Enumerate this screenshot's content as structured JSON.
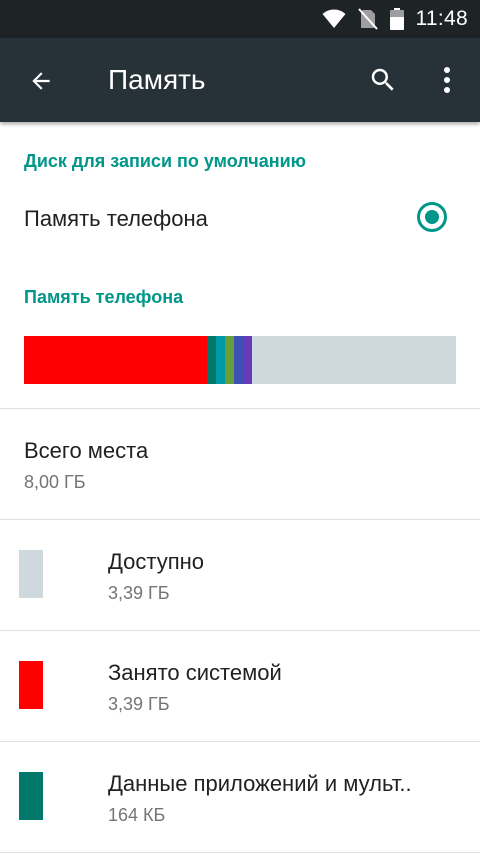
{
  "status_bar": {
    "time": "11:48",
    "icons": [
      "wifi-icon",
      "no-sim-icon",
      "battery-icon"
    ]
  },
  "app_bar": {
    "title": "Память",
    "back_icon": "arrow-back-icon",
    "search_icon": "search-icon",
    "more_icon": "more-vert-icon"
  },
  "default_disk": {
    "header": "Диск для записи по умолчанию",
    "option_label": "Память телефона",
    "selected": true
  },
  "storage": {
    "header": "Память телефона",
    "usage_segments": [
      {
        "color": "#ff0000",
        "fraction": 0.424
      },
      {
        "color": "#00796b",
        "fraction": 0.021
      },
      {
        "color": "#0097a7",
        "fraction": 0.021
      },
      {
        "color": "#689f38",
        "fraction": 0.021
      },
      {
        "color": "#3f51b5",
        "fraction": 0.021
      },
      {
        "color": "#673ab7",
        "fraction": 0.021
      }
    ],
    "free_color": "#cfd8dc",
    "total_label": "Всего места",
    "total_value": "8,00 ГБ",
    "categories": [
      {
        "label": "Доступно",
        "size": "3,39 ГБ",
        "color": "#cfd8dc"
      },
      {
        "label": "Занято системой",
        "size": "3,39 ГБ",
        "color": "#ff0000"
      },
      {
        "label": "Данные приложений и мульт..",
        "size": "164 КБ",
        "color": "#00796b"
      }
    ]
  },
  "colors": {
    "accent": "#009688",
    "app_bar": "#263238",
    "status_bar": "#1e2326"
  }
}
